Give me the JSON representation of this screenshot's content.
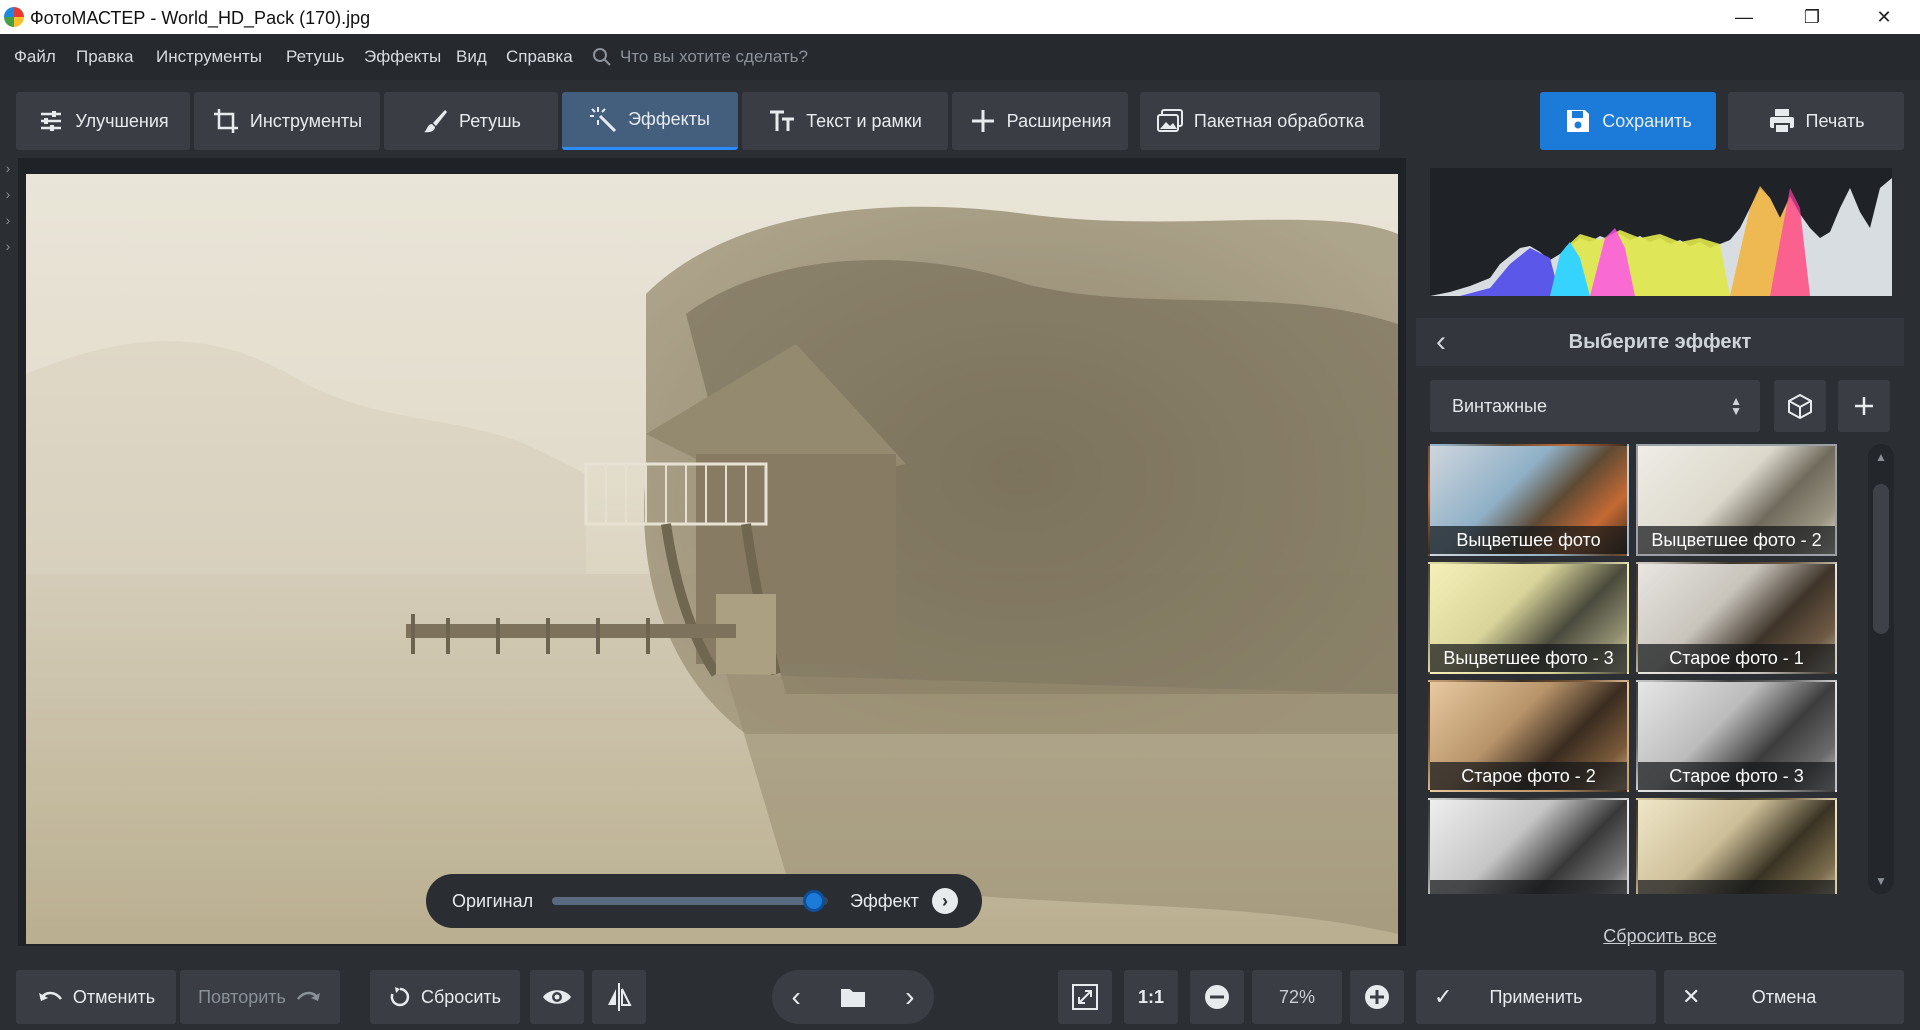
{
  "window": {
    "title": "ФотоМАСТЕР - World_HD_Pack (170).jpg",
    "minimize": "—",
    "restore": "❐",
    "close": "✕"
  },
  "menu": [
    "Файл",
    "Правка",
    "Инструменты",
    "Ретушь",
    "Эффекты",
    "Вид",
    "Справка"
  ],
  "search": {
    "placeholder": "Что вы хотите сделать?"
  },
  "tabs": [
    {
      "label": "Улучшения",
      "icon": "sliders-icon"
    },
    {
      "label": "Инструменты",
      "icon": "crop-icon"
    },
    {
      "label": "Ретушь",
      "icon": "brush-icon"
    },
    {
      "label": "Эффекты",
      "icon": "magic-wand-icon",
      "active": true
    },
    {
      "label": "Текст и рамки",
      "icon": "text-icon"
    },
    {
      "label": "Расширения",
      "icon": "plus-icon"
    },
    {
      "label": "Пакетная обработка",
      "icon": "images-icon"
    }
  ],
  "actions": {
    "save": "Сохранить",
    "print": "Печать"
  },
  "compare": {
    "original": "Оригинал",
    "effect": "Эффект",
    "level": 0.95
  },
  "effects": {
    "header": "Выберите эффект",
    "category": "Винтажные",
    "items": [
      {
        "label": "Выцветшее фото"
      },
      {
        "label": "Выцветшее фото - 2",
        "selected": true
      },
      {
        "label": "Выцветшее фото - 3"
      },
      {
        "label": "Старое фото - 1"
      },
      {
        "label": "Старое фото - 2"
      },
      {
        "label": "Старое фото - 3"
      },
      {
        "label": ""
      },
      {
        "label": ""
      }
    ],
    "reset_all": "Сбросить все"
  },
  "bottom": {
    "undo": "Отменить",
    "redo": "Повторить",
    "reset": "Сбросить",
    "ratio": "1:1",
    "zoom": "72%",
    "apply": "Применить",
    "cancel": "Отмена"
  },
  "colors": {
    "accent": "#1c7ad9",
    "panel": "#3a3e44",
    "bg": "#2b2e33"
  }
}
